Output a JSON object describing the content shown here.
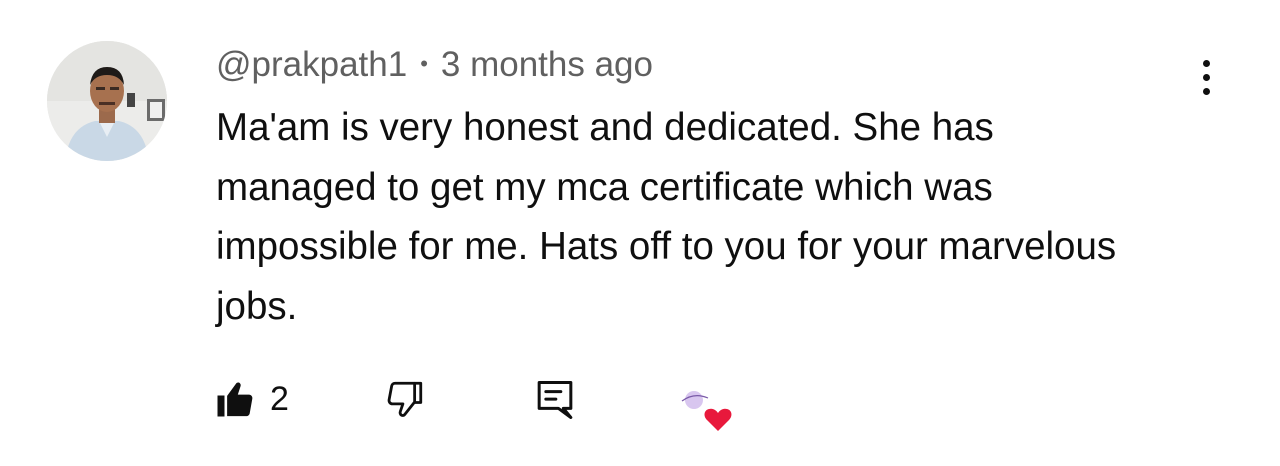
{
  "comment": {
    "author_handle": "@prakpath1",
    "separator": "•",
    "timestamp": "3 months ago",
    "text": "Ma'am is very honest and dedicated. She has managed to get my mca certificate which was impossible for me. Hats off to you for your marvelous jobs.",
    "like_count": "2"
  },
  "icons": {
    "like": "thumbs-up-filled-icon",
    "dislike": "thumbs-down-outline-icon",
    "reply": "reply-comment-icon",
    "more": "vertical-dots-icon",
    "creator_heart": "creator-heart-icon"
  },
  "colors": {
    "text_primary": "#0f0f0f",
    "text_secondary": "#606060",
    "heart": "#e8193c",
    "avatar_mini": "#c9b3e8"
  }
}
